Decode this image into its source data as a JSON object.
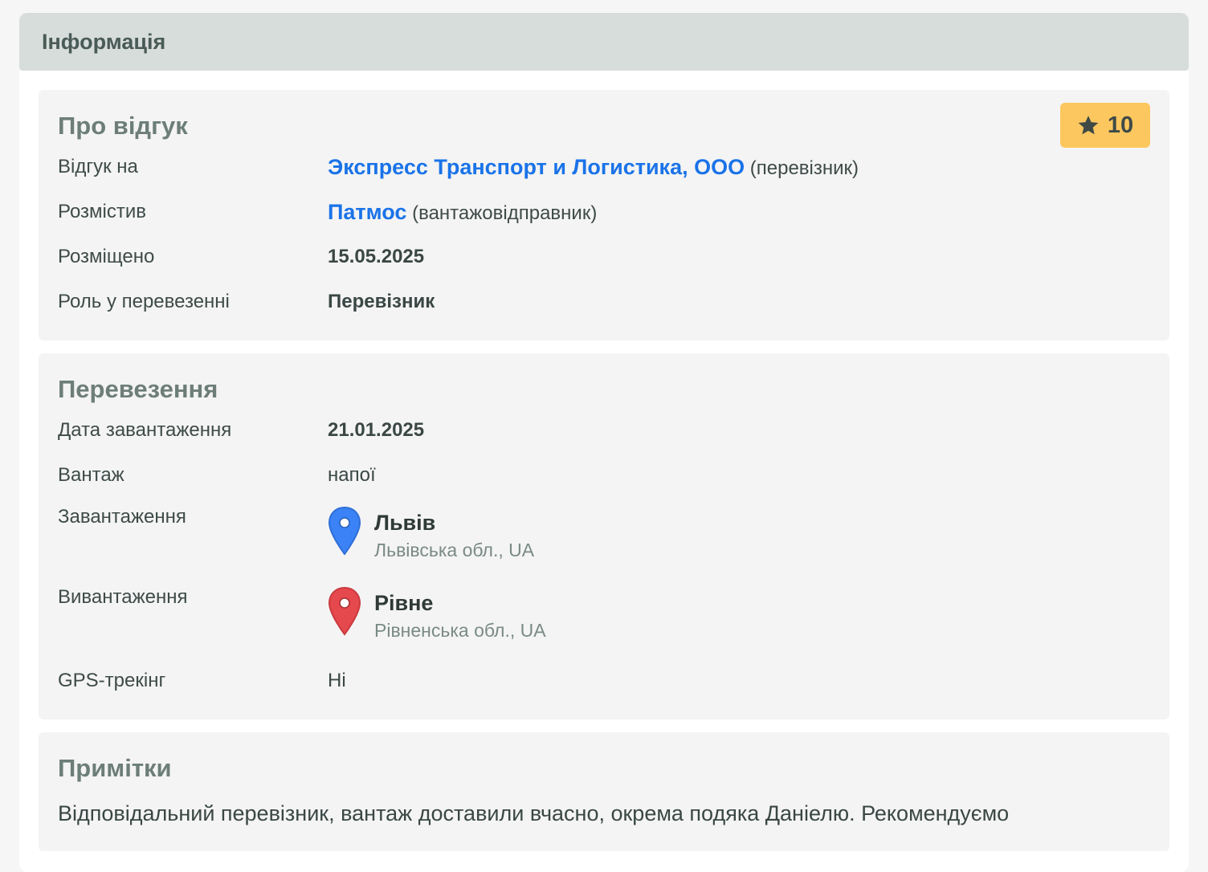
{
  "header": {
    "title": "Інформація"
  },
  "review": {
    "title": "Про відгук",
    "rating": {
      "icon": "star-icon",
      "value": "10"
    },
    "rows": {
      "review_for": {
        "label": "Відгук на",
        "link": "Экспресс Транспорт и Логистика, ООО",
        "suffix": "(перевізник)"
      },
      "posted_by": {
        "label": "Розмістив",
        "link": "Патмос",
        "suffix": "(вантажовідправник)"
      },
      "posted_on": {
        "label": "Розміщено",
        "value": "15.05.2025"
      },
      "role": {
        "label": "Роль у перевезенні",
        "value": "Перевізник"
      }
    }
  },
  "shipment": {
    "title": "Перевезення",
    "loading_date": {
      "label": "Дата завантаження",
      "value": "21.01.2025"
    },
    "cargo": {
      "label": "Вантаж",
      "value": "напої"
    },
    "loading": {
      "label": "Завантаження",
      "city": "Львів",
      "region": "Львівська обл., UA",
      "pin_color": "#3b82f6",
      "icon": "map-pin-icon"
    },
    "unloading": {
      "label": "Вивантаження",
      "city": "Рівне",
      "region": "Рівненська обл., UA",
      "pin_color": "#e5484d",
      "icon": "map-pin-icon"
    },
    "gps": {
      "label": "GPS-трекінг",
      "value": "Ні"
    }
  },
  "notes": {
    "title": "Примітки",
    "text": "Відповідальний перевізник, вантаж доставили вчасно, окрема подяка Даніелю. Рекомендуємо"
  },
  "colors": {
    "header_bg": "#d7dddb",
    "card_bg": "#f4f4f4",
    "link": "#1a73e8",
    "rating_bg": "#fcc75e"
  }
}
